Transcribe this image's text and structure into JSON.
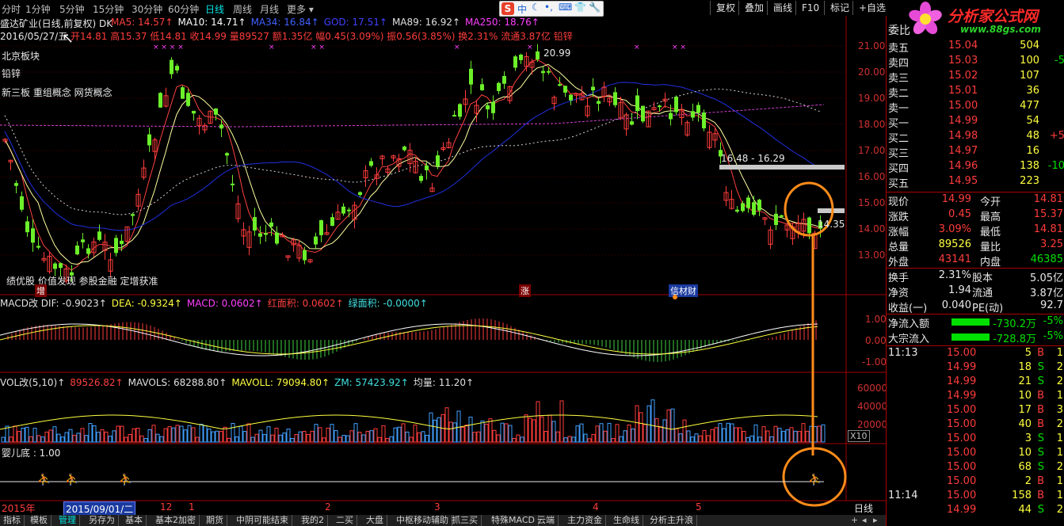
{
  "toolbar": {
    "periods": [
      "分时",
      "1分钟",
      "5分钟",
      "15分钟",
      "30分钟",
      "60分钟",
      "日线",
      "周线",
      "月线",
      "更多"
    ],
    "active_period": "日线",
    "right_buttons": [
      "复权",
      "叠加",
      "画线",
      "F10",
      "标记",
      "+自选"
    ],
    "ime_label": "中"
  },
  "logo": {
    "title": "分析家公式网",
    "url": "www.88gs.com"
  },
  "chart": {
    "title": "盛达矿业(日线,前复权) DK",
    "ma_labels": [
      {
        "text": "MA5: 14.57",
        "color": "#ff4040"
      },
      {
        "text": "MA10: 14.71",
        "color": "#ffffff"
      },
      {
        "text": "MA34: 16.84",
        "color": "#4060ff"
      },
      {
        "text": "GOD: 17.51",
        "color": "#4040ff"
      },
      {
        "text": "MA89: 16.92",
        "color": "#e0e0e0"
      },
      {
        "text": "MA250: 18.76",
        "color": "#ff40ff"
      }
    ],
    "date_line": "2016/05/27/五",
    "ohlc_line": "开14.81 高15.37 低14.81 收14.99 量89527 额1.35亿 幅0.45(3.09%) 振0.56(3.85%) 换2.31% 流通3.87亿 铅锌",
    "overlay_texts": [
      "北京板块",
      "铅锌",
      "新三板 重组概念 网货概念"
    ],
    "bottom_note": "绩优股 价值发现 参股金融 定增获准",
    "price_ticks": [
      "21.00",
      "20.00",
      "19.00",
      "18.00",
      "17.00",
      "16.00",
      "15.00",
      "14.00",
      "13.00"
    ],
    "high_label": "20.99",
    "range_label": "16.48 - 16.29",
    "low_label": "14.35",
    "event_tags": [
      "增",
      "涨",
      "信材财"
    ]
  },
  "macd": {
    "labels": [
      {
        "text": "MACD改 DIF: -0.9023",
        "color": "#e0e0e0"
      },
      {
        "text": "DEA: -0.9324",
        "color": "#ffff40"
      },
      {
        "text": "MACD: 0.0602",
        "color": "#ff40ff"
      },
      {
        "text": "红面积: 0.0602",
        "color": "#ff4040"
      },
      {
        "text": "绿面积: -0.0000",
        "color": "#40e0e0"
      }
    ],
    "ticks": [
      "1.00",
      "0.00",
      "-1.00"
    ]
  },
  "vol": {
    "labels": [
      {
        "text": "VOL改(5,10)",
        "color": "#e0e0e0"
      },
      {
        "text": "89526.82",
        "color": "#ff4040"
      },
      {
        "text": "MAVOLS: 68288.80",
        "color": "#e0e0e0"
      },
      {
        "text": "MAVOLL: 79094.80",
        "color": "#ffff40"
      },
      {
        "text": "ZM: 57423.92",
        "color": "#40e0e0"
      },
      {
        "text": "均量: 11.20",
        "color": "#e0e0e0"
      }
    ],
    "ticks": [
      "60000",
      "40000",
      "20000"
    ],
    "unit": "X10"
  },
  "baby": {
    "label": "婴儿底 : 1.00"
  },
  "xaxis": {
    "labels": [
      "2015年",
      "2015/09/01/二",
      "12",
      "1",
      "2",
      "3",
      "4",
      "5"
    ],
    "period_btn": "日线"
  },
  "orderbook": {
    "title_fragment": "委比",
    "sells": [
      {
        "label": "卖五",
        "price": "15.04",
        "vol": "504",
        "chg": ""
      },
      {
        "label": "卖四",
        "price": "15.03",
        "vol": "100",
        "chg": "-5"
      },
      {
        "label": "卖三",
        "price": "15.02",
        "vol": "107",
        "chg": ""
      },
      {
        "label": "卖二",
        "price": "15.01",
        "vol": "36",
        "chg": ""
      },
      {
        "label": "卖一",
        "price": "15.00",
        "vol": "477",
        "chg": ""
      }
    ],
    "buys": [
      {
        "label": "买一",
        "price": "14.99",
        "vol": "54",
        "chg": ""
      },
      {
        "label": "买二",
        "price": "14.98",
        "vol": "48",
        "chg": "+5"
      },
      {
        "label": "买三",
        "price": "14.97",
        "vol": "16",
        "chg": ""
      },
      {
        "label": "买四",
        "price": "14.96",
        "vol": "138",
        "chg": "-10"
      },
      {
        "label": "买五",
        "price": "14.95",
        "vol": "223",
        "chg": ""
      }
    ]
  },
  "quote": [
    {
      "l1": "现价",
      "v1": "14.99",
      "c1": "red",
      "l2": "今开",
      "v2": "14.81",
      "c2": "red"
    },
    {
      "l1": "涨跌",
      "v1": "0.45",
      "c1": "red",
      "l2": "最高",
      "v2": "15.37",
      "c2": "red"
    },
    {
      "l1": "涨幅",
      "v1": "3.09%",
      "c1": "red",
      "l2": "最低",
      "v2": "14.81",
      "c2": "red"
    },
    {
      "l1": "总量",
      "v1": "89526",
      "c1": "yellow",
      "l2": "量比",
      "v2": "3.25",
      "c2": "red"
    },
    {
      "l1": "外盘",
      "v1": "43141",
      "c1": "red",
      "l2": "内盘",
      "v2": "46385",
      "c2": "green"
    }
  ],
  "stats": [
    {
      "l1": "换手",
      "v1": "2.31%",
      "l2": "股本",
      "v2": "5.05亿"
    },
    {
      "l1": "净资",
      "v1": "1.94",
      "l2": "流通",
      "v2": "3.87亿"
    },
    {
      "l1": "收益(一)",
      "v1": "0.040",
      "l2": "PE(动)",
      "v2": "92.7"
    }
  ],
  "flows": [
    {
      "label": "净流入额",
      "value": "-730.2万",
      "pct": "-5%"
    },
    {
      "label": "大宗流入",
      "value": "-728.8万",
      "pct": "-5%"
    }
  ],
  "ticks_list": [
    {
      "time": "11:13",
      "price": "15.00",
      "vol": "5",
      "side": "B",
      "n": "1"
    },
    {
      "time": "",
      "price": "14.99",
      "vol": "18",
      "side": "S",
      "n": "2"
    },
    {
      "time": "",
      "price": "14.99",
      "vol": "21",
      "side": "S",
      "n": "2"
    },
    {
      "time": "",
      "price": "14.99",
      "vol": "10",
      "side": "B",
      "n": "1"
    },
    {
      "time": "",
      "price": "15.00",
      "vol": "17",
      "side": "B",
      "n": "3"
    },
    {
      "time": "",
      "price": "15.00",
      "vol": "40",
      "side": "B",
      "n": "2"
    },
    {
      "time": "",
      "price": "15.00",
      "vol": "3",
      "side": "S",
      "n": "1"
    },
    {
      "time": "",
      "price": "15.00",
      "vol": "10",
      "side": "S",
      "n": "1"
    },
    {
      "time": "",
      "price": "15.00",
      "vol": "68",
      "side": "S",
      "n": "2"
    },
    {
      "time": "",
      "price": "15.00",
      "vol": "2",
      "side": "B",
      "n": "1"
    },
    {
      "time": "11:14",
      "price": "15.00",
      "vol": "158",
      "side": "B",
      "n": "1"
    },
    {
      "time": "",
      "price": "14.99",
      "vol": "44",
      "side": "S",
      "n": "2"
    }
  ],
  "bottom_tabs": [
    "指标",
    "模板",
    "管理",
    "另存为",
    "基本",
    "基本2加密",
    "期货",
    "中阴可能结束",
    "我的2",
    "二买",
    "大盘",
    "中枢移动辅助",
    "抓三买",
    "特殊MACD",
    "云端",
    "主力资金",
    "生命线",
    "分析主升浪"
  ],
  "active_tab": "管理"
}
